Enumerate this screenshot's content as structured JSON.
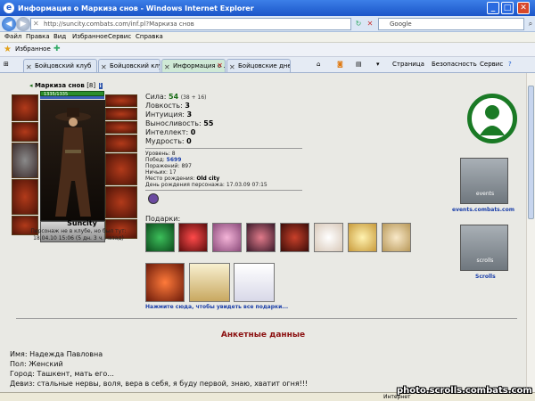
{
  "window": {
    "title": "Информация о Маркиза снов - Windows Internet Explorer"
  },
  "address": {
    "url": "http://suncity.combats.com/inf.pl?Маркиза снов",
    "search_placeholder": "Google"
  },
  "menu": [
    "Файл",
    "Правка",
    "Вид",
    "Избранное",
    "Сервис",
    "Справка"
  ],
  "favorites": {
    "label": "Избранное"
  },
  "tabs": [
    {
      "label": "Бойцовский клуб",
      "active": false
    },
    {
      "label": "Бойцовский клуб",
      "active": false
    },
    {
      "label": "Информация о ...",
      "active": true
    },
    {
      "label": "Бойцовские днев...",
      "active": false
    }
  ],
  "toolbar": {
    "page": "Страница",
    "security": "Безопасность",
    "tools": "Сервис"
  },
  "character": {
    "name": "Маркиза снов",
    "level": "[8]",
    "hp": "1335/1335",
    "city": "Suncity",
    "offline_line1": "Персонаж не в клубе, но был тут:",
    "offline_line2": "18.04.10 15:06 (5 дн. 3 ч. назад)"
  },
  "stats": {
    "strength_label": "Сила:",
    "strength": "54",
    "strength_extra": "(38 + 16)",
    "agility_label": "Ловкость:",
    "agility": "3",
    "intuition_label": "Интуиция:",
    "intuition": "3",
    "endurance_label": "Выносливость:",
    "endurance": "55",
    "intellect_label": "Интеллект:",
    "intellect": "0",
    "wisdom_label": "Мудрость:",
    "wisdom": "0"
  },
  "info": {
    "level_label": "Уровень:",
    "level": "8",
    "wins_label": "Побед:",
    "wins": "5699",
    "losses_label": "Поражений:",
    "losses": "897",
    "draws_label": "Ничьих:",
    "draws": "17",
    "birthplace_label": "Место рождения:",
    "birthplace": "Old city",
    "birthday_label": "День рождения персонажа:",
    "birthday": "17.03.09 07:15"
  },
  "gifts": {
    "title": "Подарки:",
    "link": "Нажмите сюда, чтобы увидеть все подарки..."
  },
  "side": {
    "events_link": "events.combats.com",
    "scrolls_link": "Scrolls",
    "events_banner_text": "events",
    "scrolls_banner_text": "scrolls"
  },
  "bio": {
    "title": "Анкетные данные",
    "name": "Имя: Надежда Павловна",
    "gender": "Пол: Женский",
    "city": "Город: Ташкент, мать его...",
    "motto": "Девиз: стальные нервы, воля, вера в себя, я буду первой, знаю, хватит огня!!!"
  },
  "status": {
    "zone": "Интернет"
  },
  "watermark": "photo.scrolls.combats.com"
}
